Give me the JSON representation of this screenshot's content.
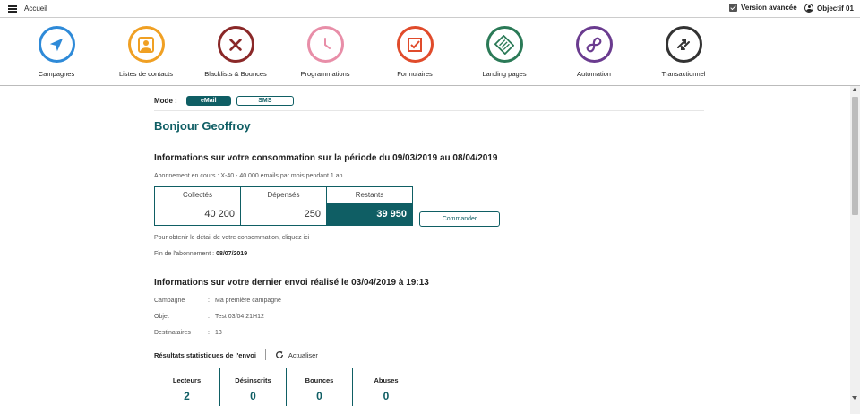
{
  "topbar": {
    "home_label": "Accueil",
    "advanced_label": "Version avancée",
    "user_label": "Objectif 01"
  },
  "modules": [
    {
      "label": "Campagnes",
      "icon": "navigation-arrow-icon",
      "color": "#2e8ad8"
    },
    {
      "label": "Listes de contacts",
      "icon": "contact-icon",
      "color": "#f0a023"
    },
    {
      "label": "Blacklists & Bounces",
      "icon": "x-circle-icon",
      "color": "#8a2828"
    },
    {
      "label": "Programmations",
      "icon": "clock-icon",
      "color": "#e88ea8"
    },
    {
      "label": "Formulaires",
      "icon": "form-check-icon",
      "color": "#e04b2b"
    },
    {
      "label": "Landing pages",
      "icon": "page-icon",
      "color": "#2b7a57"
    },
    {
      "label": "Automation",
      "icon": "infinity-icon",
      "color": "#6a3b8f"
    },
    {
      "label": "Transactionnel",
      "icon": "transfer-arrows-icon",
      "color": "#333333"
    }
  ],
  "mode": {
    "label": "Mode :",
    "email": "eMail",
    "sms": "SMS"
  },
  "greeting": "Bonjour Geoffroy",
  "consumption": {
    "title": "Informations sur votre consommation sur la période du 09/03/2019 au 08/04/2019",
    "subscription": "Abonnement en cours : X-40 - 40.000 emails par mois pendant 1 an",
    "headers": [
      "Collectés",
      "Dépensés",
      "Restants"
    ],
    "values": [
      "40 200",
      "250",
      "39 950"
    ],
    "order_button": "Commander",
    "detail_text": "Pour obtenir le détail de votre consommation, cliquez ici",
    "end_label": "Fin de l'abonnement :",
    "end_date": "08/07/2019"
  },
  "last_send": {
    "title": "Informations sur votre dernier envoi réalisé le 03/04/2019 à 19:13",
    "rows": [
      {
        "key": "Campagne",
        "value": "Ma première campagne"
      },
      {
        "key": "Objet",
        "value": "Test 03/04 21H12"
      },
      {
        "key": "Destinataires",
        "value": "13"
      }
    ],
    "results_label": "Résultats statistiques de l'envoi",
    "refresh_label": "Actualiser",
    "stats": [
      {
        "label": "Lecteurs",
        "value": "2"
      },
      {
        "label": "Désinscrits",
        "value": "0"
      },
      {
        "label": "Bounces",
        "value": "0"
      },
      {
        "label": "Abuses",
        "value": "0"
      }
    ]
  },
  "accent_color": "#0f5e64"
}
